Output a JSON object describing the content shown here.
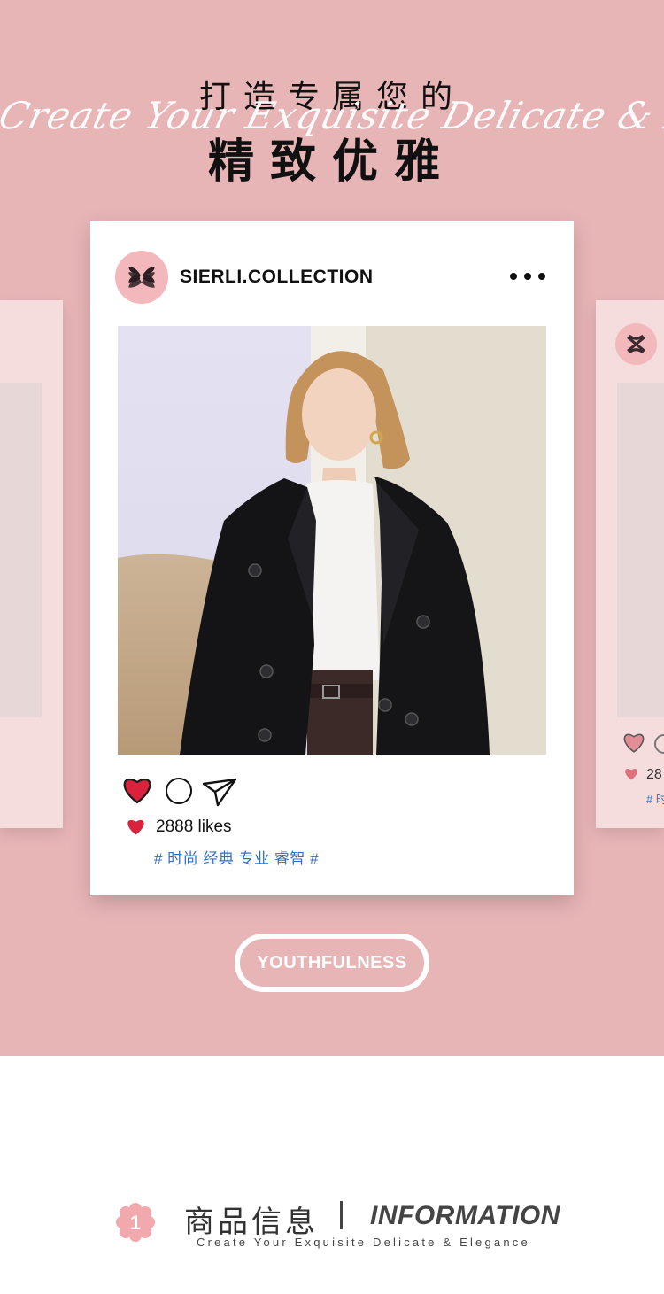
{
  "header": {
    "title_line1": "打造专属您的",
    "script_text": "Create Your Exquisite Delicate & Elegance",
    "title_line2": "精致优雅"
  },
  "post": {
    "account_name": "SIERLI.COLLECTION",
    "likes": "2888 likes",
    "tags": "# 时尚 经典 专业 睿智 #"
  },
  "side_card_right": {
    "likes_partial": "28",
    "tags_partial": "# 时"
  },
  "badge": {
    "label": "YOUTHFULNESS"
  },
  "info": {
    "number": "1",
    "title_cn": "商品信息",
    "title_en": "INFORMATION",
    "subtitle": "Create Your Exquisite Delicate & Elegance"
  },
  "colors": {
    "background_pink": "#e8b5b7",
    "logo_pink": "#f2b8bb",
    "heart_red": "#d9233d",
    "tag_blue": "#2f6fc4"
  },
  "icons": [
    "logo-icon",
    "more-icon",
    "heart-icon",
    "comment-icon",
    "share-icon",
    "flower-icon"
  ]
}
